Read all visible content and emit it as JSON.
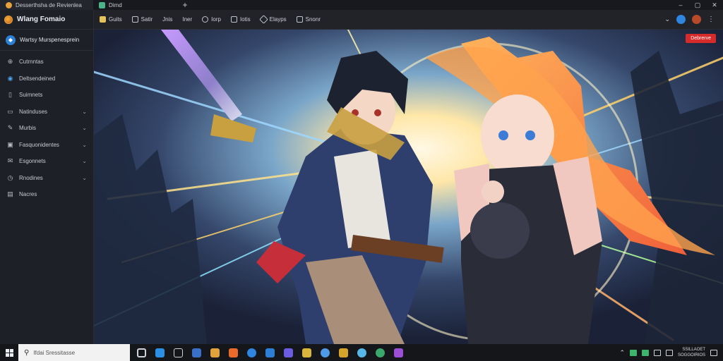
{
  "tabs": [
    {
      "label": "Desserthsha de Revienlea",
      "favicon_color": "#e8a23c"
    },
    {
      "label": "Dimd",
      "favicon_color": "#4bb28a"
    }
  ],
  "app": {
    "title": "Wlang Fomaio",
    "workspace": "Wartsy Murspenesprein"
  },
  "sidebar": {
    "items": [
      {
        "label": "Cutrnntas",
        "icon": "globe-icon",
        "has_chevron": false
      },
      {
        "label": "Deltsendeined",
        "icon": "compass-icon",
        "has_chevron": false
      },
      {
        "label": "Suimnets",
        "icon": "document-icon",
        "has_chevron": false
      },
      {
        "label": "Natinduses",
        "icon": "book-icon",
        "has_chevron": true
      },
      {
        "label": "Murbis",
        "icon": "brush-icon",
        "has_chevron": true
      },
      {
        "label": "Fasquonidentes",
        "icon": "calendar-icon",
        "has_chevron": true
      },
      {
        "label": "Esgonnets",
        "icon": "mail-icon",
        "has_chevron": true
      },
      {
        "label": "Rnodines",
        "icon": "clock-icon",
        "has_chevron": true
      },
      {
        "label": "Nacres",
        "icon": "image-icon",
        "has_chevron": false
      }
    ]
  },
  "toolbar": {
    "items": [
      {
        "label": "Guits",
        "icon_color": "#e5c35a"
      },
      {
        "label": "Satir",
        "icon_color": "#bfc3cc"
      },
      {
        "label": "Jnis",
        "icon_color": "#bfc3cc"
      },
      {
        "label": "Iner",
        "icon_color": "#bfc3cc"
      },
      {
        "label": "Iorp",
        "icon_color": "#bfc3cc"
      },
      {
        "label": "Iotis",
        "icon_color": "#bfc3cc"
      },
      {
        "label": "Elayps",
        "icon_color": "#bfc3cc"
      },
      {
        "label": "Snonr",
        "icon_color": "#bfc3cc"
      }
    ],
    "badge": "Debrerve"
  },
  "taskbar": {
    "search_placeholder": "Ifdai Sressitasse",
    "clock_line1": "SSILLAOET",
    "clock_line2": "SOGGOIRIOS",
    "apps": [
      "#2b8fe3",
      "#cfd3da",
      "#3a6fc8",
      "#e0a23a",
      "#e96a2b",
      "#2f86e0",
      "#2c7fd4",
      "#6b5ce3",
      "#d9b53c",
      "#4e9be8",
      "#d6a32b",
      "#57b8e8",
      "#3aa76b",
      "#9b4fd6"
    ],
    "accent_color": "#3db36e"
  },
  "colors": {
    "badge": "#d72a2a",
    "accent": "#2e7fd6"
  }
}
